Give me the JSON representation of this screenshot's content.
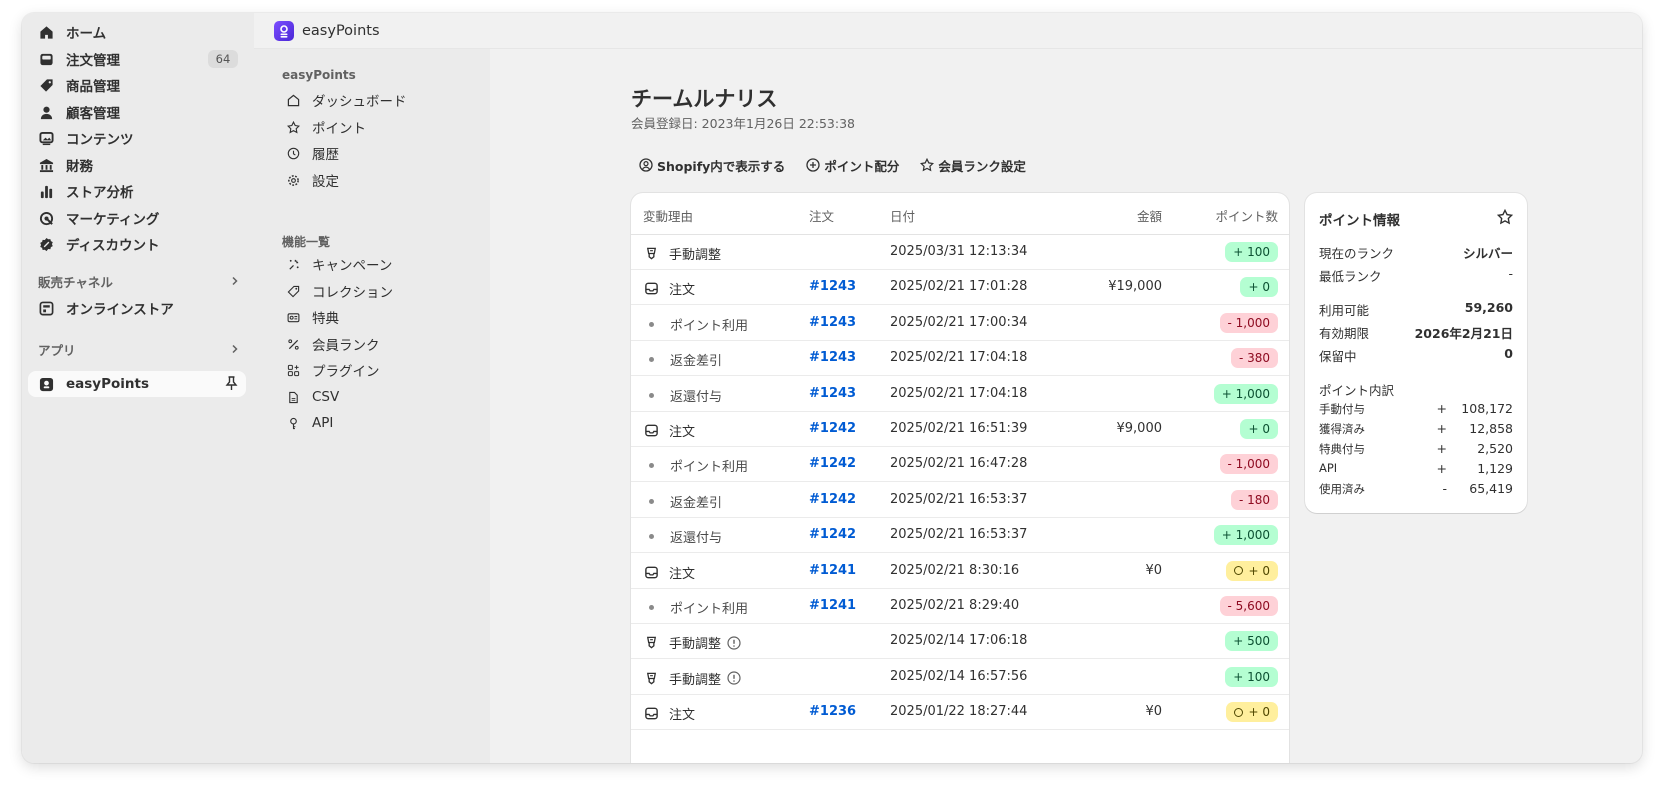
{
  "nav": {
    "items": [
      {
        "label": "ホーム",
        "icon": "home-icon"
      },
      {
        "label": "注文管理",
        "icon": "inbox-icon",
        "badge": "64"
      },
      {
        "label": "商品管理",
        "icon": "tag-icon"
      },
      {
        "label": "顧客管理",
        "icon": "person-icon"
      },
      {
        "label": "コンテンツ",
        "icon": "image-icon"
      },
      {
        "label": "財務",
        "icon": "bank-icon"
      },
      {
        "label": "ストア分析",
        "icon": "bar-chart-icon"
      },
      {
        "label": "マーケティング",
        "icon": "target-icon"
      },
      {
        "label": "ディスカウント",
        "icon": "discount-icon"
      }
    ],
    "sales_channels_label": "販売チャネル",
    "online_store_label": "オンラインストア",
    "apps_label": "アプリ",
    "app_item_label": "easyPoints"
  },
  "appbar": {
    "title": "easyPoints"
  },
  "subnav": {
    "group1_head": "easyPoints",
    "group1": [
      "ダッシュボード",
      "ポイント",
      "履歴",
      "設定"
    ],
    "group2_head": "機能一覧",
    "group2": [
      "キャンペーン",
      "コレクション",
      "特典",
      "会員ランク",
      "プラグイン",
      "CSV",
      "API"
    ]
  },
  "page": {
    "title": "チームルナリス",
    "subtitle": "会員登録日: 2023年1月26日 22:53:38",
    "actions": [
      "Shopify内で表示する",
      "ポイント配分",
      "会員ランク設定"
    ]
  },
  "table": {
    "headers": {
      "reason": "変動理由",
      "order": "注文",
      "date": "日付",
      "amount": "金額",
      "points": "ポイント数"
    },
    "rows": [
      {
        "reason": "手動調整",
        "kind": "manual",
        "order": "",
        "date": "2025/03/31 12:13:34",
        "amount": "",
        "points": "+ 100",
        "tone": "pos",
        "info": false
      },
      {
        "reason": "注文",
        "kind": "order",
        "order": "#1243",
        "date": "2025/02/21 17:01:28",
        "amount": "¥19,000",
        "points": "+ 0",
        "tone": "pos",
        "info": false
      },
      {
        "reason": "ポイント利用",
        "kind": "sub",
        "order": "#1243",
        "date": "2025/02/21 17:00:34",
        "amount": "",
        "points": "- 1,000",
        "tone": "neg",
        "info": false
      },
      {
        "reason": "返金差引",
        "kind": "sub",
        "order": "#1243",
        "date": "2025/02/21 17:04:18",
        "amount": "",
        "points": "- 380",
        "tone": "neg",
        "info": false
      },
      {
        "reason": "返還付与",
        "kind": "sub",
        "order": "#1243",
        "date": "2025/02/21 17:04:18",
        "amount": "",
        "points": "+ 1,000",
        "tone": "pos",
        "info": false
      },
      {
        "reason": "注文",
        "kind": "order",
        "order": "#1242",
        "date": "2025/02/21 16:51:39",
        "amount": "¥9,000",
        "points": "+ 0",
        "tone": "pos",
        "info": false
      },
      {
        "reason": "ポイント利用",
        "kind": "sub",
        "order": "#1242",
        "date": "2025/02/21 16:47:28",
        "amount": "",
        "points": "- 1,000",
        "tone": "neg",
        "info": false
      },
      {
        "reason": "返金差引",
        "kind": "sub",
        "order": "#1242",
        "date": "2025/02/21 16:53:37",
        "amount": "",
        "points": "- 180",
        "tone": "neg",
        "info": false
      },
      {
        "reason": "返還付与",
        "kind": "sub",
        "order": "#1242",
        "date": "2025/02/21 16:53:37",
        "amount": "",
        "points": "+ 1,000",
        "tone": "pos",
        "info": false
      },
      {
        "reason": "注文",
        "kind": "order",
        "order": "#1241",
        "date": "2025/02/21 8:30:16",
        "amount": "¥0",
        "points": "+ 0",
        "tone": "pend",
        "info": false
      },
      {
        "reason": "ポイント利用",
        "kind": "sub",
        "order": "#1241",
        "date": "2025/02/21 8:29:40",
        "amount": "",
        "points": "- 5,600",
        "tone": "neg",
        "info": false
      },
      {
        "reason": "手動調整",
        "kind": "manual",
        "order": "",
        "date": "2025/02/14 17:06:18",
        "amount": "",
        "points": "+ 500",
        "tone": "pos",
        "info": true
      },
      {
        "reason": "手動調整",
        "kind": "manual",
        "order": "",
        "date": "2025/02/14 16:57:56",
        "amount": "",
        "points": "+ 100",
        "tone": "pos",
        "info": true
      },
      {
        "reason": "注文",
        "kind": "order",
        "order": "#1236",
        "date": "2025/01/22 18:27:44",
        "amount": "¥0",
        "points": "+ 0",
        "tone": "pend",
        "info": false
      }
    ]
  },
  "info": {
    "title": "ポイント情報",
    "rank_label": "現在のランク",
    "rank_value": "シルバー",
    "min_rank_label": "最低ランク",
    "min_rank_value": "-",
    "available_label": "利用可能",
    "available_value": "59,260",
    "expiry_label": "有効期限",
    "expiry_value": "2026年2月21日",
    "pending_label": "保留中",
    "pending_value": "0",
    "breakdown_label": "ポイント内訳",
    "breakdown": [
      {
        "label": "手動付与",
        "sign": "+",
        "value": "108,172"
      },
      {
        "label": "獲得済み",
        "sign": "+",
        "value": "12,858"
      },
      {
        "label": "特典付与",
        "sign": "+",
        "value": "2,520"
      },
      {
        "label": "API",
        "sign": "+",
        "value": "1,129"
      },
      {
        "label": "使用済み",
        "sign": "-",
        "value": "65,419"
      }
    ]
  },
  "colors": {
    "link": "#005bd3",
    "positive_bg": "#b4fed2",
    "negative_bg": "#fed1d7",
    "pending_bg": "#ffef9d",
    "brand": "#5b35e6"
  }
}
